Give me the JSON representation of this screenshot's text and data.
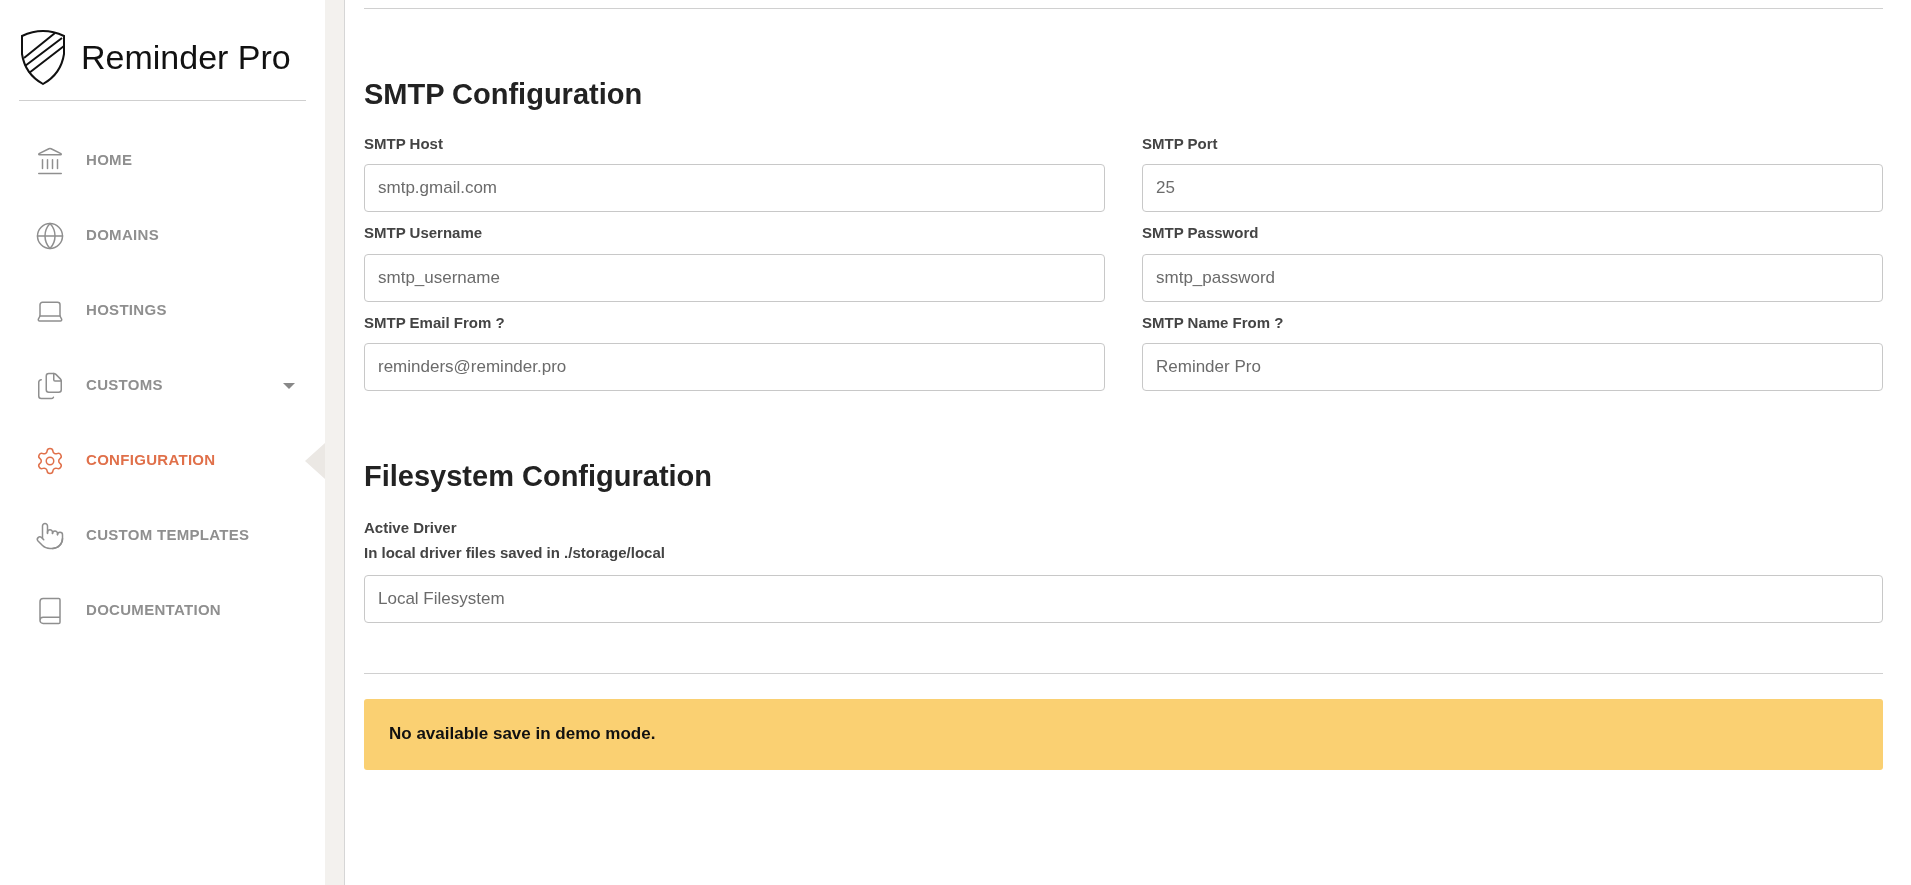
{
  "brand": {
    "name": "Reminder Pro"
  },
  "sidebar": {
    "items": [
      {
        "label": "HOME",
        "kind": "home",
        "selected": false,
        "has_submenu": false
      },
      {
        "label": "DOMAINS",
        "kind": "domains",
        "selected": false,
        "has_submenu": false
      },
      {
        "label": "HOSTINGS",
        "kind": "hostings",
        "selected": false,
        "has_submenu": false
      },
      {
        "label": "CUSTOMS",
        "kind": "customs",
        "selected": false,
        "has_submenu": true
      },
      {
        "label": "CONFIGURATION",
        "kind": "configuration",
        "selected": true,
        "has_submenu": false
      },
      {
        "label": "CUSTOM TEMPLATES",
        "kind": "templates",
        "selected": false,
        "has_submenu": false
      },
      {
        "label": "DOCUMENTATION",
        "kind": "documentation",
        "selected": false,
        "has_submenu": false
      }
    ]
  },
  "smtp": {
    "title": "SMTP Configuration",
    "fields": [
      {
        "label": "SMTP Host",
        "value": "smtp.gmail.com"
      },
      {
        "label": "SMTP Port",
        "value": "25"
      },
      {
        "label": "SMTP Username",
        "value": "smtp_username"
      },
      {
        "label": "SMTP Password",
        "value": "smtp_password"
      },
      {
        "label": "SMTP Email From ?",
        "value": "reminders@reminder.pro"
      },
      {
        "label": "SMTP Name From ?",
        "value": "Reminder Pro"
      }
    ]
  },
  "filesystem": {
    "title": "Filesystem Configuration",
    "label": "Active Driver",
    "hint": "In local driver files saved in ./storage/local",
    "value": "Local Filesystem"
  },
  "alert": {
    "text": "No available save in demo mode."
  }
}
